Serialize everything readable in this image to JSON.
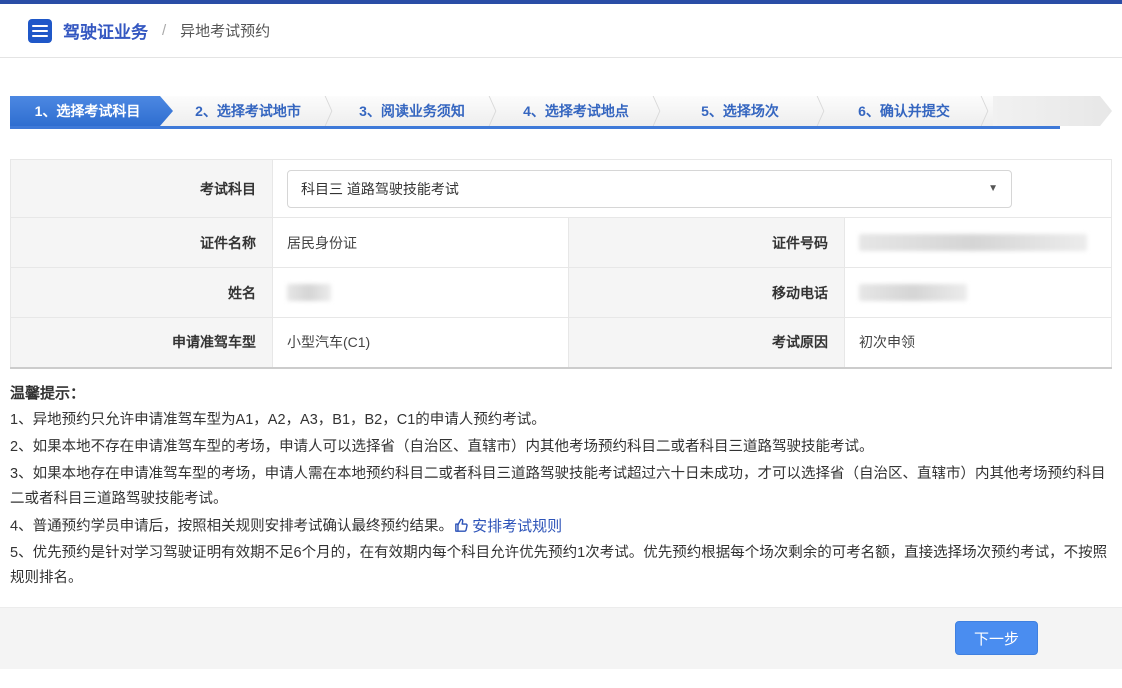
{
  "colors": {
    "topbar": "#2a4da6",
    "title_blue": "#3457c1",
    "tab_active": "#3c7bd9",
    "tab_underline": "#3e79d8",
    "tab_text": "#3566c0",
    "link_blue": "#2d53b8",
    "button_blue": "#4a8df0",
    "label_bg": "#f5f5f5"
  },
  "header": {
    "icon": "list-icon",
    "title": "驾驶证业务",
    "separator": "/",
    "breadcrumb": "异地考试预约"
  },
  "steps": [
    {
      "label": "1、选择考试科目",
      "active": true
    },
    {
      "label": "2、选择考试地市",
      "active": false
    },
    {
      "label": "3、阅读业务须知",
      "active": false
    },
    {
      "label": "4、选择考试地点",
      "active": false
    },
    {
      "label": "5、选择场次",
      "active": false
    },
    {
      "label": "6、确认并提交",
      "active": false
    }
  ],
  "form": {
    "row1": {
      "label": "考试科目",
      "select_value": "科目三 道路驾驶技能考试",
      "caret": "▼"
    },
    "row2": {
      "left_label": "证件名称",
      "left_value": "居民身份证",
      "right_label": "证件号码",
      "right_value_redacted": true
    },
    "row3": {
      "left_label": "姓名",
      "left_value_redacted": true,
      "right_label": "移动电话",
      "right_value_redacted": true
    },
    "row4": {
      "left_label": "申请准驾车型",
      "left_value": "小型汽车(C1)",
      "right_label": "考试原因",
      "right_value": "初次申领"
    }
  },
  "tips": {
    "title": "温馨提示：",
    "item1": "1、异地预约只允许申请准驾车型为A1，A2，A3，B1，B2，C1的申请人预约考试。",
    "item2": "2、如果本地不存在申请准驾车型的考场，申请人可以选择省（自治区、直辖市）内其他考场预约科目二或者科目三道路驾驶技能考试。",
    "item3": "3、如果本地存在申请准驾车型的考场，申请人需在本地预约科目二或者科目三道路驾驶技能考试超过六十日未成功，才可以选择省（自治区、直辖市）内其他考场预约科目二或者科目三道路驾驶技能考试。",
    "item4": "4、普通预约学员申请后，按照相关规则安排考试确认最终预约结果。",
    "item4_link": "安排考试规则",
    "item5": "5、优先预约是针对学习驾驶证明有效期不足6个月的，在有效期内每个科目允许优先预约1次考试。优先预约根据每个场次剩余的可考名额，直接选择场次预约考试，不按照规则排名。"
  },
  "footer": {
    "next_label": "下一步"
  }
}
